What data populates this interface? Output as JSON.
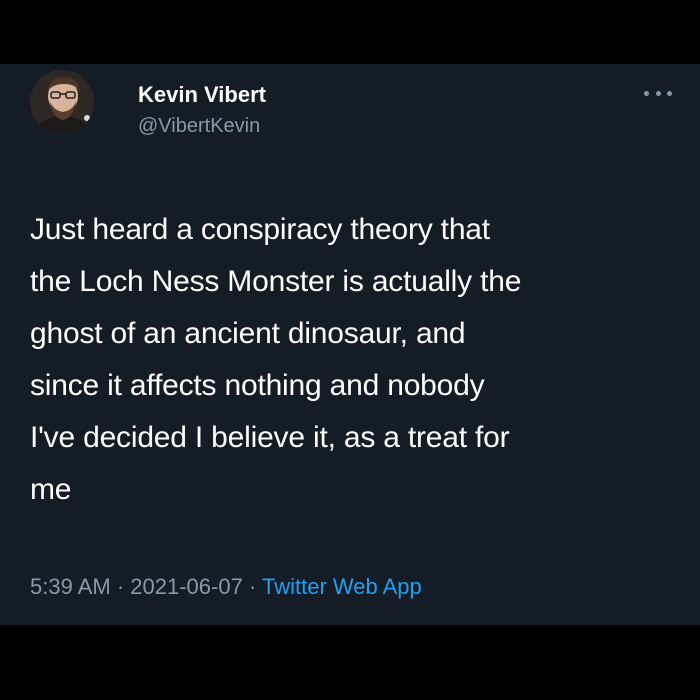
{
  "tweet": {
    "author_name": "Kevin Vibert",
    "author_handle": "@VibertKevin",
    "text": "Just heard a conspiracy theory that\nthe Loch Ness Monster is actually the\nghost of an ancient dinosaur, and\nsince it affects nothing and nobody\nI've decided I believe it, as a treat for\nme",
    "time": "5:39 AM",
    "date": "2021-06-07",
    "source": "Twitter Web App",
    "separator": " · "
  },
  "icons": {
    "avatar": "profile-photo",
    "more": "more-options-icon"
  },
  "colors": {
    "page_background": "#000000",
    "card_background": "#141d26",
    "primary_text": "#ffffff",
    "secondary_text": "#8899a6",
    "link": "#1da1f2"
  }
}
